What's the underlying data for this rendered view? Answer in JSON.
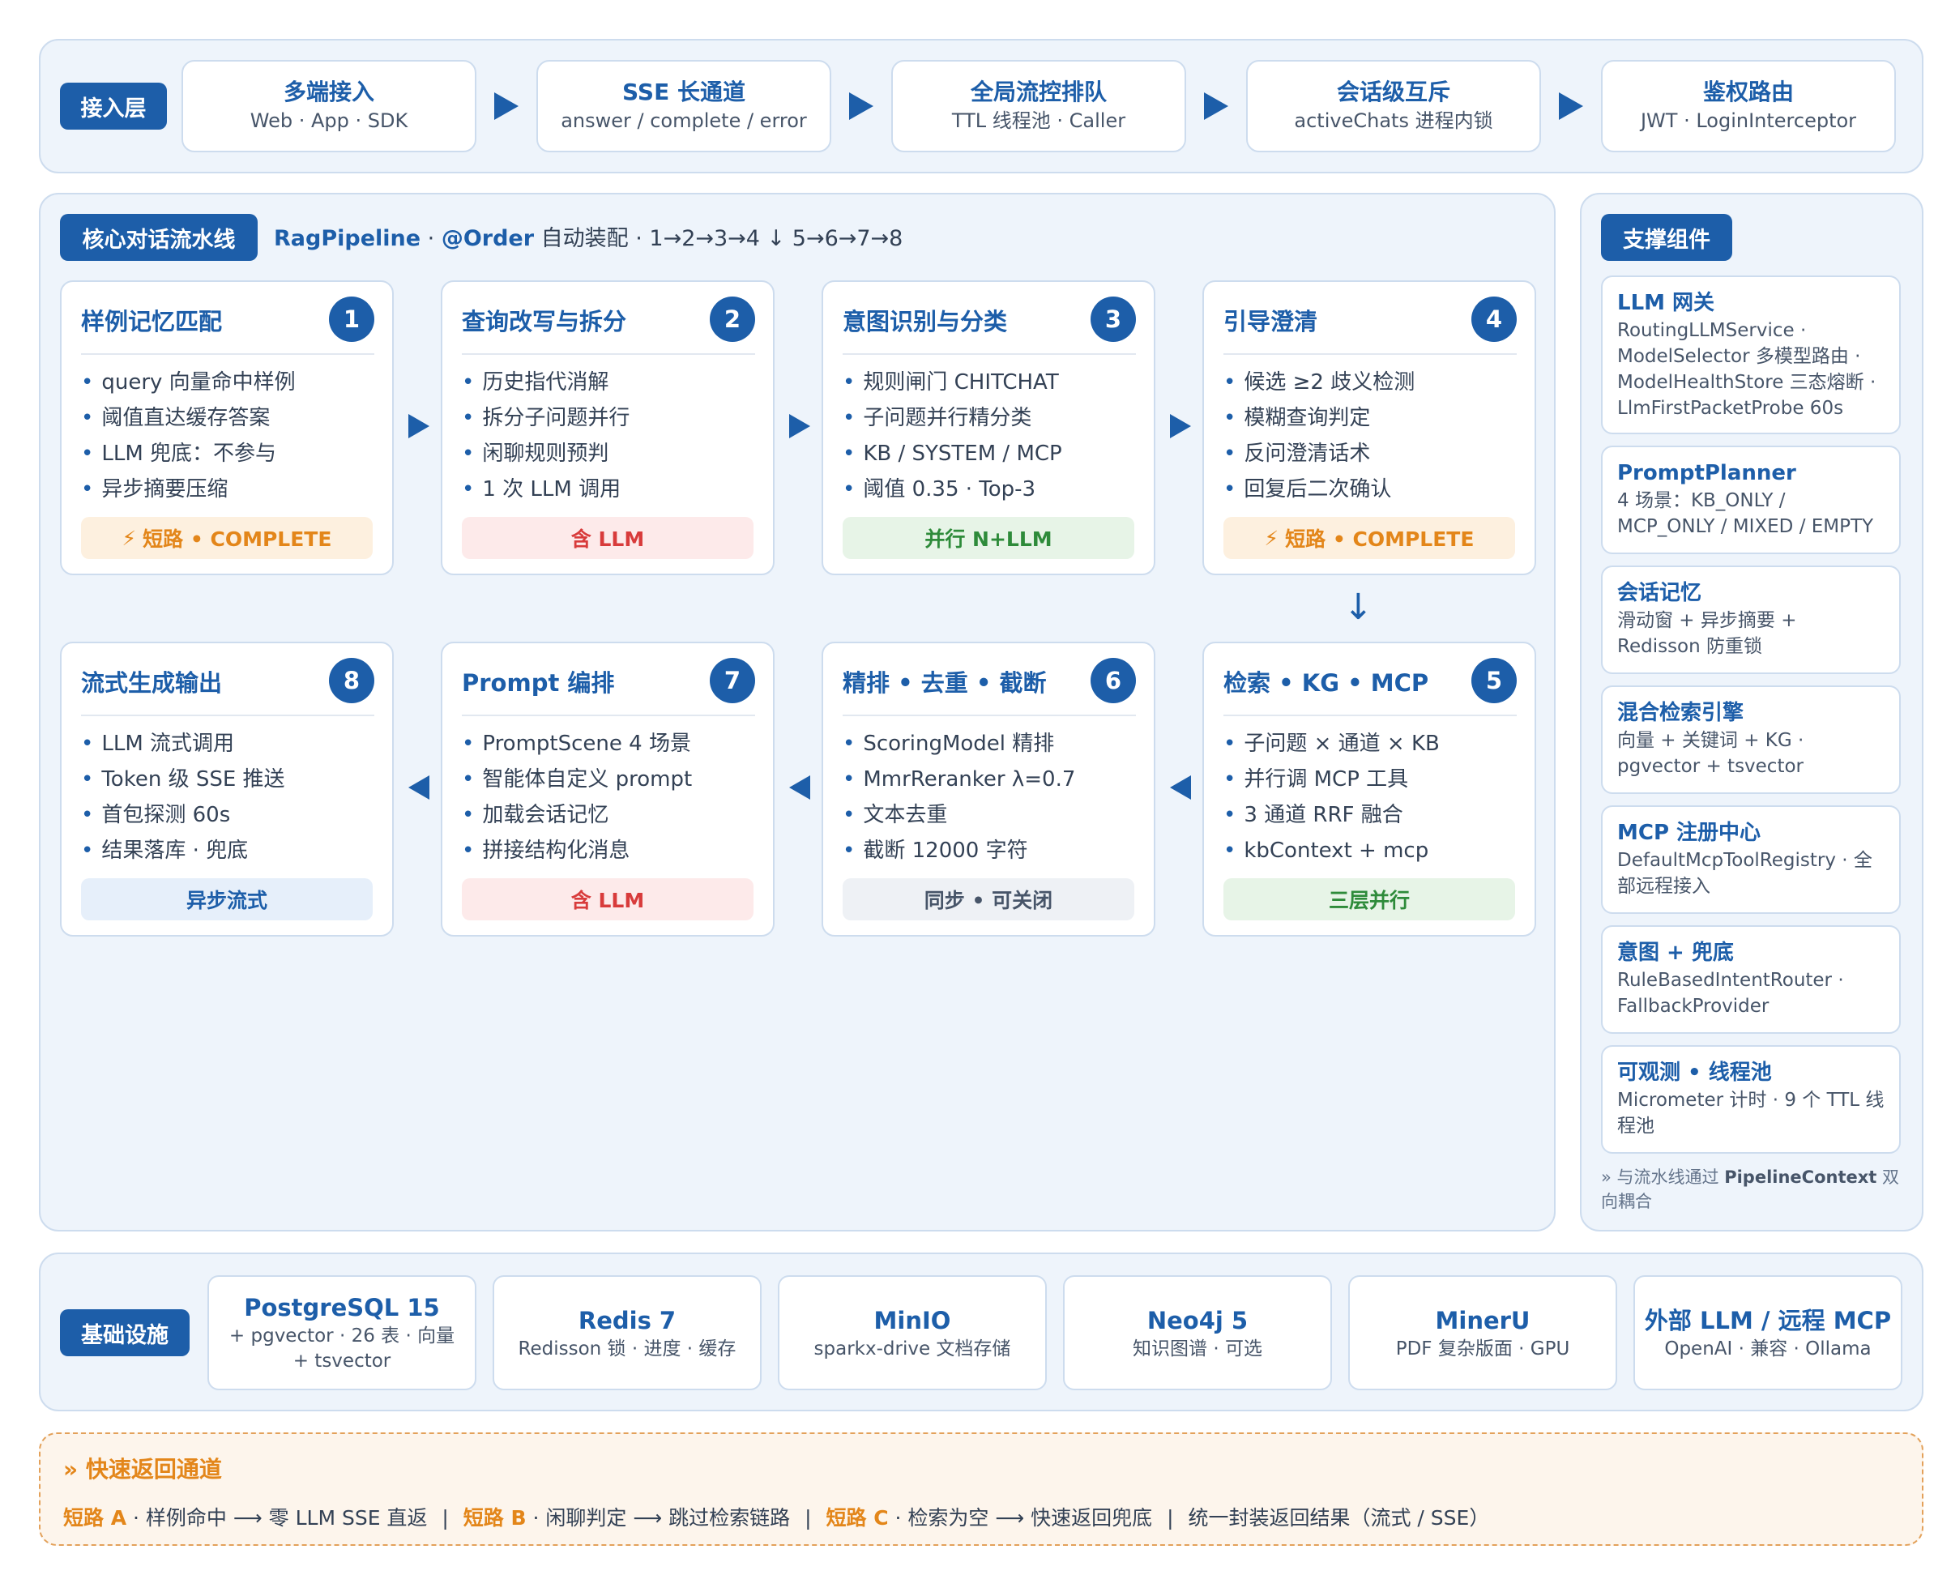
{
  "access_layer": {
    "tag": "接入层",
    "items": [
      {
        "title": "多端接入",
        "sub": "Web · App · SDK"
      },
      {
        "title": "SSE 长通道",
        "sub": "answer / complete / error"
      },
      {
        "title": "全局流控排队",
        "sub": "TTL 线程池 · Caller"
      },
      {
        "title": "会话级互斥",
        "sub": "activeChats 进程内锁"
      },
      {
        "title": "鉴权路由",
        "sub": "JWT · LoginInterceptor"
      }
    ]
  },
  "pipeline": {
    "tag": "核心对话流水线",
    "head_strong1": "RagPipeline",
    "head_sep": " · ",
    "head_strong2": "@Order",
    "head_rest": " 自动装配 · 1→2→3→4 ↓ 5→6→7→8",
    "down_arrow": "↓",
    "cards": [
      {
        "num": "1",
        "title": "样例记忆匹配",
        "items": [
          "query 向量命中样例",
          "阈值直达缓存答案",
          "LLM 兜底：不参与",
          "异步摘要压缩"
        ],
        "badge": "短路 • COMPLETE",
        "badge_icon": "⚡",
        "badge_color": "orange"
      },
      {
        "num": "2",
        "title": "查询改写与拆分",
        "items": [
          "历史指代消解",
          "拆分子问题并行",
          "闲聊规则预判",
          "1 次 LLM 调用"
        ],
        "badge": "含 LLM",
        "badge_color": "red"
      },
      {
        "num": "3",
        "title": "意图识别与分类",
        "items": [
          "规则闸门 CHITCHAT",
          "子问题并行精分类",
          "KB / SYSTEM / MCP",
          "阈值 0.35 · Top-3"
        ],
        "badge": "并行 N+LLM",
        "badge_color": "green"
      },
      {
        "num": "4",
        "title": "引导澄清",
        "items": [
          "候选 ≥2 歧义检测",
          "模糊查询判定",
          "反问澄清话术",
          "回复后二次确认"
        ],
        "badge": "短路 • COMPLETE",
        "badge_icon": "⚡",
        "badge_color": "orange"
      },
      {
        "num": "5",
        "title": "检索 • KG • MCP",
        "items": [
          "子问题 × 通道 × KB",
          "并行调 MCP 工具",
          "3 通道 RRF 融合",
          "kbContext + mcp"
        ],
        "badge": "三层并行",
        "badge_color": "green"
      },
      {
        "num": "6",
        "title": "精排 • 去重 • 截断",
        "items": [
          "ScoringModel 精排",
          "MmrReranker λ=0.7",
          "文本去重",
          "截断 12000 字符"
        ],
        "badge": "同步 • 可关闭",
        "badge_color": "gray"
      },
      {
        "num": "7",
        "title": "Prompt 编排",
        "items": [
          "PromptScene 4 场景",
          "智能体自定义 prompt",
          "加载会话记忆",
          "拼接结构化消息"
        ],
        "badge": "含 LLM",
        "badge_color": "red"
      },
      {
        "num": "8",
        "title": "流式生成输出",
        "items": [
          "LLM 流式调用",
          "Token 级 SSE 推送",
          "首包探测 60s",
          "结果落库 · 兜底"
        ],
        "badge": "异步流式",
        "badge_color": "blue"
      }
    ]
  },
  "support": {
    "tag": "支撑组件",
    "items": [
      {
        "title": "LLM 网关",
        "desc": "RoutingLLMService · ModelSelector 多模型路由 · ModelHealthStore 三态熔断 · LlmFirstPacketProbe 60s"
      },
      {
        "title": "PromptPlanner",
        "desc": "4 场景：KB_ONLY / MCP_ONLY / MIXED / EMPTY"
      },
      {
        "title": "会话记忆",
        "desc": "滑动窗 + 异步摘要 + Redisson 防重锁"
      },
      {
        "title": "混合检索引擎",
        "desc": "向量 + 关键词 + KG · pgvector + tsvector"
      },
      {
        "title": "MCP 注册中心",
        "desc": "DefaultMcpToolRegistry · 全部远程接入"
      },
      {
        "title": "意图 + 兜底",
        "desc": "RuleBasedIntentRouter · FallbackProvider"
      },
      {
        "title": "可观测 • 线程池",
        "desc": "Micrometer 计时 · 9 个 TTL 线程池"
      }
    ],
    "footer_pre": "» 与流水线通过 ",
    "footer_strong": "PipelineContext",
    "footer_post": " 双向耦合"
  },
  "infra": {
    "tag": "基础设施",
    "items": [
      {
        "title": "PostgreSQL 15",
        "sub": "+ pgvector · 26 表 · 向量 + tsvector"
      },
      {
        "title": "Redis 7",
        "sub": "Redisson 锁 · 进度 · 缓存"
      },
      {
        "title": "MinIO",
        "sub": "sparkx-drive 文档存储"
      },
      {
        "title": "Neo4j 5",
        "sub": "知识图谱 · 可选"
      },
      {
        "title": "MinerU",
        "sub": "PDF 复杂版面 · GPU"
      },
      {
        "title": "外部 LLM / 远程 MCP",
        "sub": "OpenAI · 兼容 · Ollama"
      }
    ]
  },
  "fast_path": {
    "title": "» 快速返回通道",
    "a_key": "短路 A",
    "a_text": " · 样例命中 ⟶ 零 LLM SSE 直返",
    "b_key": "短路 B",
    "b_text": " · 闲聊判定 ⟶ 跳过检索链路",
    "c_key": "短路 C",
    "c_text": " · 检索为空 ⟶ 快速返回兜底",
    "d_text": "统一封装返回结果（流式 / SSE）",
    "separator": "|"
  },
  "colors": {
    "primary": "#1d5ea9",
    "panel_bg": "#eef4fb",
    "border": "#cddcee",
    "orange": "#e3861a",
    "red": "#d83b3b",
    "green": "#2e8b3a"
  }
}
